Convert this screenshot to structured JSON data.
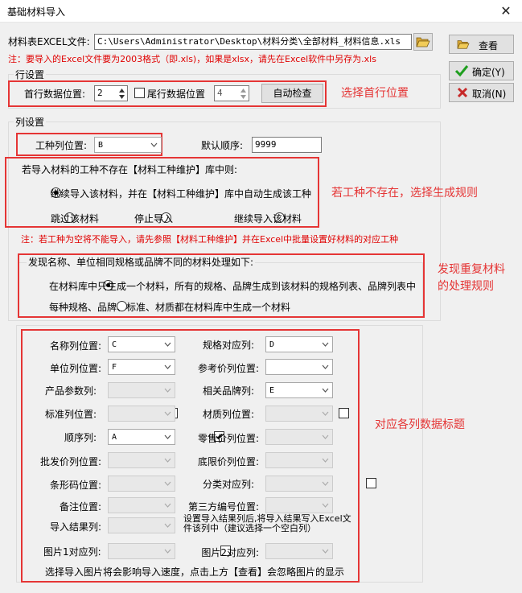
{
  "window": {
    "title": "基础材料导入",
    "close_glyph": "✕"
  },
  "file": {
    "label": "材料表EXCEL文件:",
    "path": "C:\\Users\\Administrator\\Desktop\\材料分类\\全部材料_材料信息.xls",
    "note": "注：要导入的Excel文件要为2003格式（即.xls)，如果是xlsx，请先在Excel软件中另存为.xls"
  },
  "buttons": {
    "view": "查看",
    "ok": "确定(Y)",
    "cancel": "取消(N)",
    "auto_check": "自动检查"
  },
  "row_settings": {
    "legend": "行设置",
    "first_row_label": "首行数据位置:",
    "first_row_value": "2",
    "last_row_label": "尾行数据位置",
    "last_row_value": "4",
    "last_row_checked": false
  },
  "col_settings": {
    "legend": "列设置",
    "worktype_label": "工种列位置:",
    "worktype_value": "B",
    "default_order_label": "默认顺序:",
    "default_order_value": "9999"
  },
  "worktype_rule": {
    "title": "若导入材料的工种不存在【材料工种维护】库中则:",
    "opt1": "继续导入该材料，并在【材料工种维护】库中自动生成该工种",
    "opt2": "跳过该材料",
    "opt3": "停止导入",
    "opt4": "继续导入该材料",
    "selected": 1,
    "note": "注：若工种为空将不能导入，请先参照【材料工种维护】并在Excel中批量设置好材料的对应工种"
  },
  "dup_rule": {
    "title": "发现名称、单位相同规格或品牌不同的材料处理如下:",
    "opt1": "在材料库中只生成一个材料，所有的规格、品牌生成到该材料的规格列表、品牌列表中",
    "opt2": "每种规格、品牌、标准、材质都在材料库中生成一个材料",
    "selected": 1
  },
  "annotations": {
    "first_row": "选择首行位置",
    "worktype": "若工种不存在，选择生成规则",
    "dup1": "发现重复材料",
    "dup2": "的处理规则",
    "columns": "对应各列数据标题"
  },
  "columns": {
    "name": {
      "label": "名称列位置:",
      "value": "C"
    },
    "spec": {
      "label": "规格对应列:",
      "value": "D",
      "checked": true
    },
    "unit": {
      "label": "单位列位置:",
      "value": "F"
    },
    "ref_price": {
      "label": "参考价列位置:",
      "value": ""
    },
    "product_param": {
      "label": "产品参数列:",
      "value": "",
      "checked": false
    },
    "brand": {
      "label": "相关品牌列:",
      "value": "E",
      "checked": true
    },
    "standard": {
      "label": "标准列位置:",
      "value": "",
      "checked": false
    },
    "material": {
      "label": "材质列位置:",
      "value": "",
      "checked": false
    },
    "order": {
      "label": "顺序列:",
      "value": "A",
      "checked": true
    },
    "retail_price": {
      "label": "零售价列位置:",
      "value": ""
    },
    "wholesale_price": {
      "label": "批发价列位置:",
      "value": ""
    },
    "floor_price": {
      "label": "底限价列位置:",
      "value": ""
    },
    "barcode": {
      "label": "条形码位置:",
      "value": ""
    },
    "category": {
      "label": "分类对应列:",
      "value": "",
      "checked": false
    },
    "remark": {
      "label": "备注位置:",
      "value": ""
    },
    "third_party": {
      "label": "第三方编号位置:",
      "value": ""
    },
    "import_result": {
      "label": "导入结果列:",
      "value": ""
    },
    "import_result_note": "设置导入结果列后,将导入结果写入Excel文件该列中（建议选择一个空白列）",
    "image1": {
      "label": "图片1对应列:",
      "value": "",
      "checked": false
    },
    "image2": {
      "label": "图片2对应列:",
      "value": ""
    },
    "image_note": "选择导入图片将会影响导入速度，点击上方【查看】会忽略图片的显示"
  },
  "colors": {
    "annotation": "#e53535",
    "note_red": "#e00000",
    "ok_green": "#1e9e1e",
    "cancel_red": "#c62828"
  },
  "icons": [
    "close-icon",
    "folder-open-icon",
    "checkmark-icon",
    "cross-icon",
    "spin-up-icon",
    "spin-down-icon",
    "dropdown-arrow-icon"
  ]
}
